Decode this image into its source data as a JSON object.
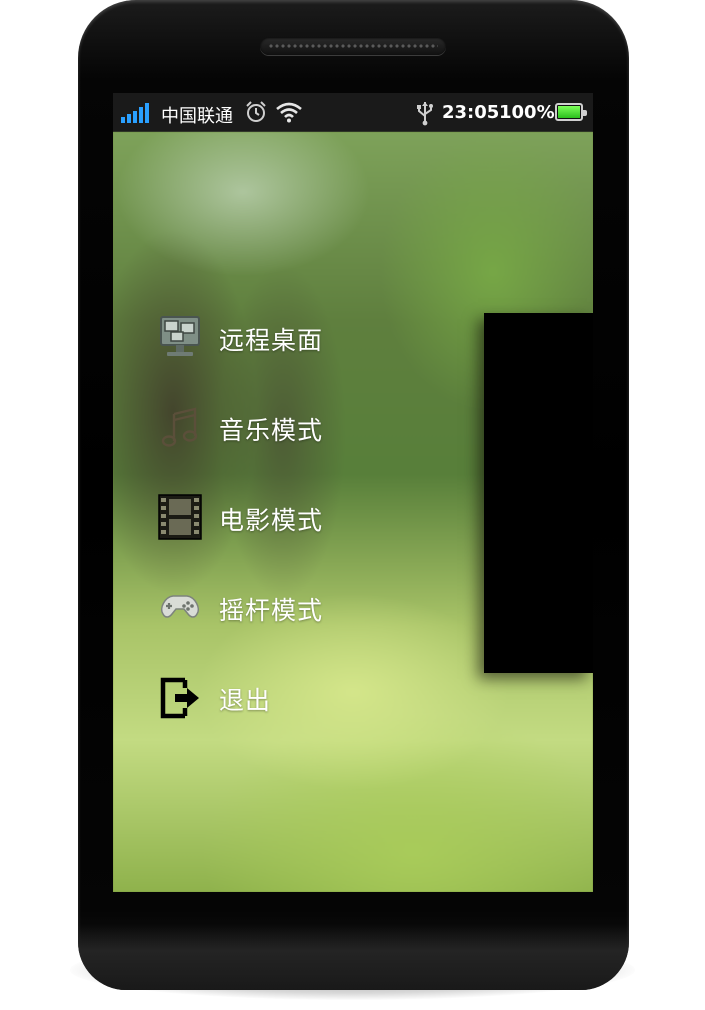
{
  "status_bar": {
    "carrier": "中国联通",
    "time": "23:05",
    "battery_percent": "100%",
    "icons": [
      "signal-icon",
      "alarm-icon",
      "wifi-icon",
      "usb-icon",
      "battery-icon"
    ]
  },
  "menu": {
    "items": [
      {
        "label": "远程桌面",
        "icon": "remote-desktop-icon"
      },
      {
        "label": "音乐模式",
        "icon": "music-note-icon"
      },
      {
        "label": "电影模式",
        "icon": "film-strip-icon"
      },
      {
        "label": "摇杆模式",
        "icon": "gamepad-icon"
      },
      {
        "label": "退出",
        "icon": "exit-icon"
      }
    ]
  },
  "colors": {
    "signal": "#2aa0ff",
    "battery": "#3fd02a",
    "status_bar_bg": "#1a1a1a",
    "menu_text": "#ffffff"
  }
}
